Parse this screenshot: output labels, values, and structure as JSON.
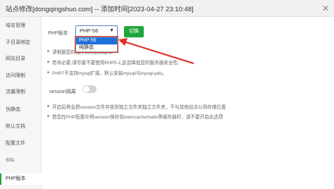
{
  "window": {
    "title": "站点修改[dongqingshuo.com] -- 添加时间[2023-04-27 23:10:48]",
    "close_icon": "close-icon"
  },
  "sidebar": {
    "items": [
      {
        "label": "域名管理"
      },
      {
        "label": "子目录绑定"
      },
      {
        "label": "网站目录"
      },
      {
        "label": "访问限制"
      },
      {
        "label": "流量限制"
      },
      {
        "label": "伪静态"
      },
      {
        "label": "默认文档"
      },
      {
        "label": "配置文件"
      },
      {
        "label": "SSL"
      },
      {
        "label": "PHP版本"
      }
    ],
    "active_index": 9
  },
  "php": {
    "label": "PHP版本",
    "selected": "PHP-56",
    "options": [
      "PHP-56",
      "纯静态"
    ],
    "switch_button": "切换"
  },
  "notes_php": [
    "请根据您的程序需求选择版本",
    "若非必要,请尽量不要使用PHP5.2,这会降低您的服务器安全性;",
    "PHP7不支持mysql扩展，默认安装mysqli与mysql-pdo。"
  ],
  "session": {
    "label": "session隔离",
    "enabled": false
  },
  "notes_session": [
    "开启后将会把session文件存放到独立文件夹独立文件夹，不与其他站点公用存储位置",
    "若您在PHP配置中将session保存到memcache/redis等缓存器时，请不要开启此选项"
  ],
  "colors": {
    "accent_green": "#20a53a",
    "highlight_red": "#e0302a",
    "select_blue": "#1e6fd9"
  }
}
